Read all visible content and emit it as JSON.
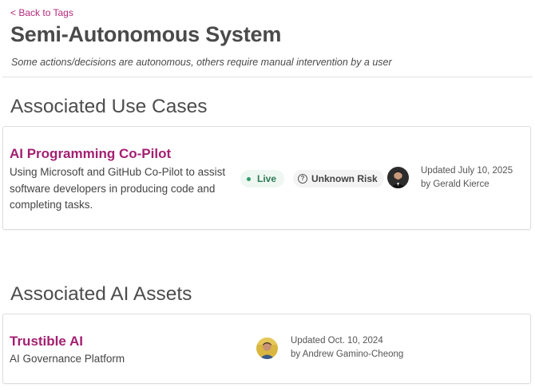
{
  "nav": {
    "back_label": "< Back to Tags"
  },
  "header": {
    "title": "Semi-Autonomous System",
    "subtitle": "Some actions/decisions are autonomous, others require manual intervention by a user"
  },
  "use_cases": {
    "heading": "Associated Use Cases",
    "items": [
      {
        "title": "AI Programming Co-Pilot",
        "description": "Using Microsoft and GitHub Co-Pilot to assist software developers in producing code and completing tasks.",
        "status": "Live",
        "risk": "Unknown Risk",
        "risk_icon": "?",
        "updated": "Updated July 10, 2025",
        "author": "by Gerald Kierce"
      }
    ]
  },
  "ai_assets": {
    "heading": "Associated AI Assets",
    "items": [
      {
        "title": "Trustible AI",
        "description": "AI Governance Platform",
        "updated": "Updated Oct. 10, 2024",
        "author": "by Andrew Gamino-Cheong"
      }
    ]
  },
  "colors": {
    "accent": "#a32071",
    "status_green": "#2f7a55",
    "status_bg": "#eef7f2",
    "risk_bg": "#f4f4f4"
  }
}
